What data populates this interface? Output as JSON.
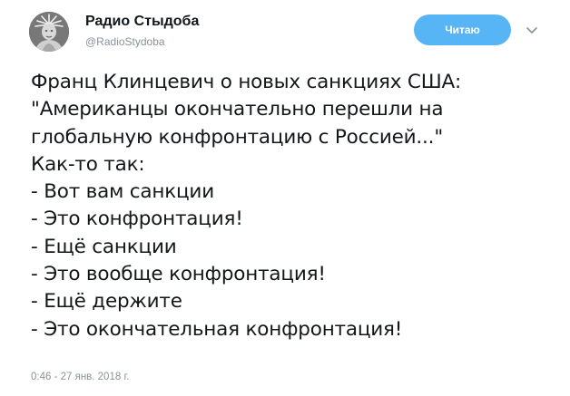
{
  "author": {
    "display_name": "Радио Стыдоба",
    "handle": "@RadioStydoba",
    "avatar_icon": "liberty-statue-avatar"
  },
  "follow_button": {
    "label": "Читаю",
    "color": "#58b5f5"
  },
  "menu_icon": "chevron-down-icon",
  "tweet": {
    "lines": [
      "Франц Клинцевич о новых санкциях США:",
      "\"Американцы окончательно перешли на",
      "глобальную конфронтацию с Россией...\"",
      "Как-то так:",
      "- Вот вам санкции",
      "- Это конфронтация!",
      "- Ещё санкции",
      "- Это вообще конфронтация!",
      "- Ещё держите",
      "- Это окончательная конфронтация!"
    ],
    "timestamp": "0:46 - 27 янв. 2018 г."
  }
}
